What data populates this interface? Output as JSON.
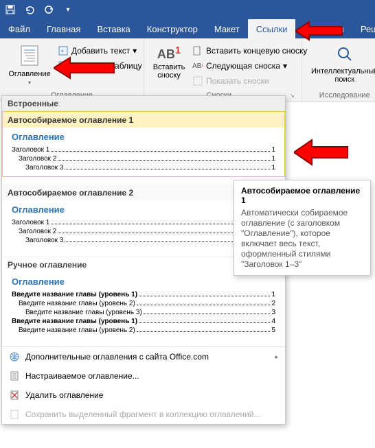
{
  "colors": {
    "brand": "#2b579a",
    "accent_link": "#2e74b5",
    "arrow": "#ff0000"
  },
  "qat": {
    "save": "save-icon",
    "undo": "undo-icon",
    "redo": "redo-icon",
    "customize": "chevron-down-icon"
  },
  "tabs": {
    "items": [
      {
        "label": "Файл"
      },
      {
        "label": "Главная"
      },
      {
        "label": "Вставка"
      },
      {
        "label": "Конструктор"
      },
      {
        "label": "Макет"
      },
      {
        "label": "Ссылки",
        "active": true
      },
      {
        "label": "Рассылки"
      },
      {
        "label": "Реце"
      }
    ]
  },
  "ribbon": {
    "toc": {
      "button": "Оглавление",
      "add_text": "Добавить текст",
      "update_table": "Обновить таблицу",
      "caption": "Оглавление"
    },
    "footnotes": {
      "insert": "Вставить\nсноску",
      "ab": "AB",
      "sup": "1",
      "end": "Вставить концевую сноску",
      "next": "Следующая сноска",
      "show": "Показать сноски",
      "caption": "Сноски"
    },
    "research": {
      "button": "Интеллектуальный\nпоиск",
      "caption": "Исследование"
    }
  },
  "gallery": {
    "section_builtin": "Встроенные",
    "options": [
      {
        "title": "Автособираемое оглавление 1",
        "heading": "Оглавление",
        "lines": [
          {
            "text": "Заголовок 1",
            "page": "1",
            "indent": 0
          },
          {
            "text": "Заголовок 2",
            "page": "1",
            "indent": 1
          },
          {
            "text": "Заголовок 3",
            "page": "1",
            "indent": 2
          }
        ]
      },
      {
        "title": "Автособираемое оглавление 2",
        "heading": "Оглавление",
        "lines": [
          {
            "text": "Заголовок 1",
            "page": "1",
            "indent": 0
          },
          {
            "text": "Заголовок 2",
            "page": "1",
            "indent": 1
          },
          {
            "text": "Заголовок 3",
            "page": "1",
            "indent": 2
          }
        ]
      }
    ],
    "section_manual": "Ручное оглавление",
    "manual": {
      "heading": "Оглавление",
      "lines": [
        {
          "text": "Введите название главы (уровень 1)",
          "page": "1",
          "indent": 0,
          "bold": true
        },
        {
          "text": "Введите название главы (уровень 2)",
          "page": "2",
          "indent": 1
        },
        {
          "text": "Введите название главы (уровень 3)",
          "page": "3",
          "indent": 2
        },
        {
          "text": "Введите название главы (уровень 1)",
          "page": "4",
          "indent": 0,
          "bold": true
        },
        {
          "text": "Введите название главы (уровень 2)",
          "page": "5",
          "indent": 1
        }
      ]
    },
    "menu": {
      "online": "Дополнительные оглавления с сайта Office.com",
      "custom": "Настраиваемое оглавление...",
      "remove": "Удалить оглавление",
      "save_selection": "Сохранить выделенный фрагмент в коллекцию оглавлений..."
    }
  },
  "tooltip": {
    "title": "Автособираемое оглавление 1",
    "body": "Автоматически собираемое оглавление (с заголовком \"Оглавление\"), которое включает весь текст, оформленный стилями \"Заголовок 1–3\""
  }
}
